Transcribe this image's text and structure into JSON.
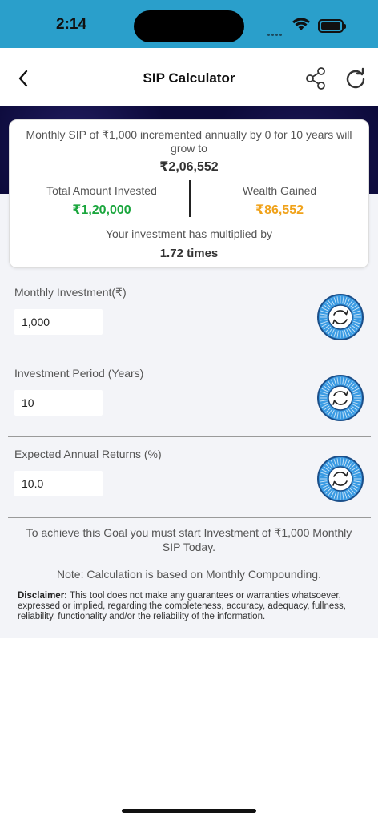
{
  "status_bar": {
    "time": "2:14",
    "signal_icon": "cellular-dots-icon",
    "wifi_icon": "wifi-icon",
    "battery_icon": "battery-icon"
  },
  "nav": {
    "title": "SIP Calculator",
    "back_icon": "chevron-left-icon",
    "share_icon": "share-icon",
    "refresh_icon": "refresh-icon"
  },
  "result": {
    "summary": "Monthly SIP of ₹1,000 incremented annually by 0 for 10 years will grow to",
    "total": "₹2,06,552",
    "invested_label": "Total Amount Invested",
    "invested_value": "₹1,20,000",
    "wealth_label": "Wealth Gained",
    "wealth_value": "₹86,552",
    "multiplied_label": "Your investment has multiplied by",
    "multiplied_value": "1.72 times"
  },
  "fields": [
    {
      "label": "Monthly Investment(₹)",
      "value": "1,000",
      "dial_icon": "rotate-dial-icon"
    },
    {
      "label": "Investment Period (Years)",
      "value": "10",
      "dial_icon": "rotate-dial-icon"
    },
    {
      "label": "Expected Annual Returns (%)",
      "value": "10.0",
      "dial_icon": "rotate-dial-icon"
    }
  ],
  "goal_text": "To achieve this Goal you must start Investment of ₹1,000 Monthly SIP Today.",
  "note_text": "Note: Calculation is based on Monthly Compounding.",
  "disclaimer": {
    "title": "Disclaimer:",
    "body": " This tool does not make any guarantees or warranties whatsoever, expressed or implied, regarding the completeness, accuracy, adequacy, fullness, reliability, functionality and/or the reliability of the information."
  },
  "colors": {
    "status_bar": "#2a9fcb",
    "dark_band": "#0c0a3a",
    "invested_green": "#1aa63d",
    "wealth_orange": "#f0a21a",
    "dial_blue": "#3a9be3"
  }
}
